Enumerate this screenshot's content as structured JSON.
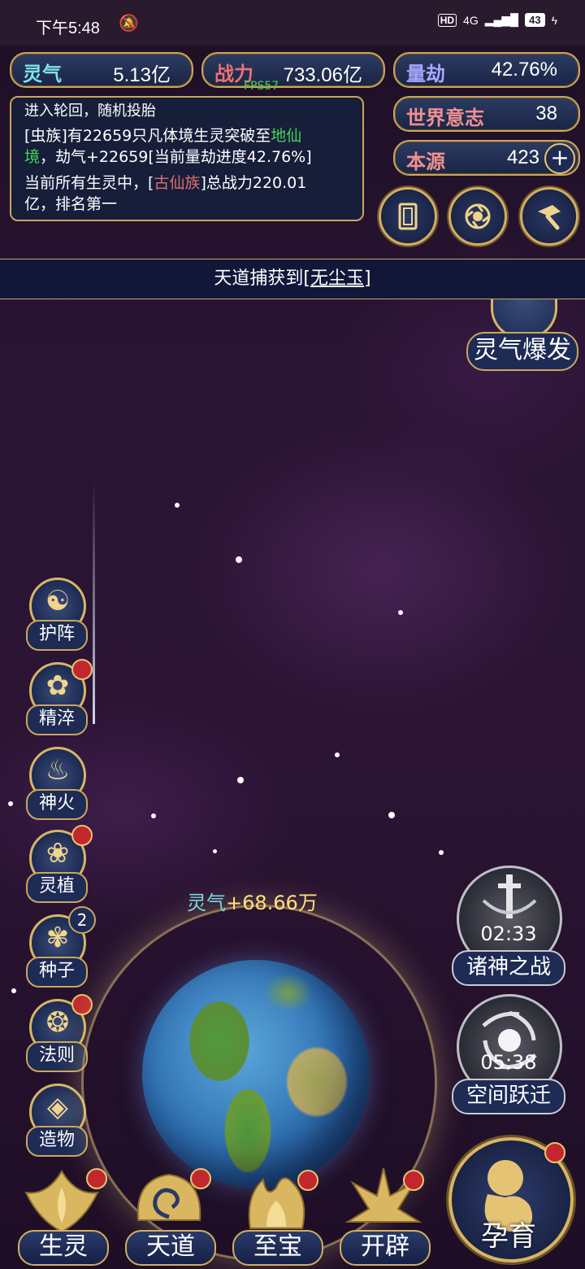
{
  "status_bar": {
    "time": "下午5:48",
    "hd": "HD",
    "network": "4G",
    "battery": "43"
  },
  "resources": {
    "lingqi": {
      "label": "灵气",
      "value": "5.13亿"
    },
    "zhanli": {
      "label": "战力",
      "value": "733.06亿"
    },
    "liangjie": {
      "label": "量劫",
      "value": "42.76%"
    },
    "shijie": {
      "label": "世界意志",
      "value": "38"
    },
    "benyuan": {
      "label": "本源",
      "value": "423",
      "add": "+"
    }
  },
  "fps": "FPS57",
  "log": {
    "line1": "进入轮回，随机投胎",
    "line2a": "[虫族]有22659只凡体境生灵突破至",
    "line2b": "地仙",
    "line3a": "境",
    "line3b": "，劫气+22659[当前量劫进度42.76%]",
    "line4a": "当前所有生灵中，[",
    "line4b": "古仙族",
    "line4c": "]总战力220.01",
    "line5": "亿，排名第一"
  },
  "banner": {
    "prefix": "天道捕获到[",
    "item": "无尘玉",
    "suffix": "]"
  },
  "burst_button": "灵气爆发",
  "side_buttons": [
    {
      "label": "护阵",
      "glyph": "☯"
    },
    {
      "label": "精淬",
      "glyph": "✿"
    },
    {
      "label": "神火",
      "glyph": "♨"
    },
    {
      "label": "灵植",
      "glyph": "❀"
    },
    {
      "label": "种子",
      "glyph": "✾",
      "badge": "2"
    },
    {
      "label": "法则",
      "glyph": "❂"
    },
    {
      "label": "造物",
      "glyph": "◈"
    }
  ],
  "gain_text": {
    "label": "灵气",
    "amount": "+68.66万"
  },
  "timers": [
    {
      "label": "诸神之战",
      "time": "02:33"
    },
    {
      "label": "空间跃迁",
      "time": "05:38"
    }
  ],
  "bottom_buttons": [
    {
      "label": "生灵"
    },
    {
      "label": "天道"
    },
    {
      "label": "至宝"
    },
    {
      "label": "开辟"
    },
    {
      "label": "孕育"
    }
  ],
  "colors": {
    "gold": "#c9a65c",
    "panel": "#1a2545",
    "alert": "#c2272d",
    "highlight_green": "#46d35a"
  }
}
